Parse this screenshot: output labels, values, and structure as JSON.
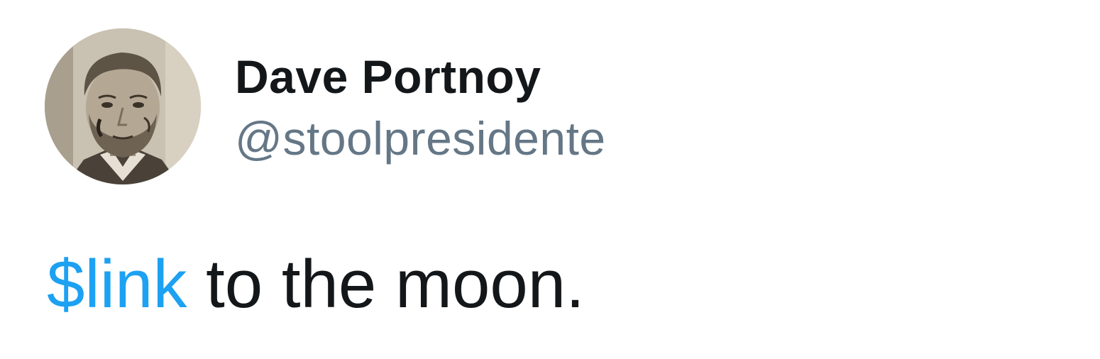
{
  "tweet": {
    "author": {
      "display_name": "Dave Portnoy",
      "handle": "@stoolpresidente",
      "avatar_icon": "profile-photo"
    },
    "body": {
      "cashtag": "$link",
      "text": " to the moon."
    }
  },
  "colors": {
    "text_primary": "#14171a",
    "text_secondary": "#657786",
    "link": "#1da1f2",
    "background": "#ffffff"
  }
}
